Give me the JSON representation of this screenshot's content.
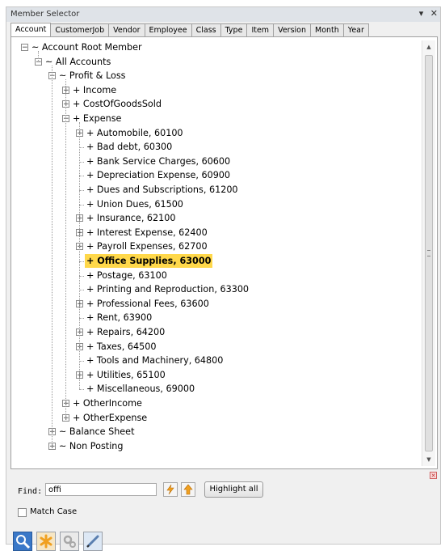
{
  "window": {
    "title": "Member Selector",
    "dropdown_glyph": "▾",
    "close_glyph": "✕"
  },
  "tabs": [
    {
      "label": "Account",
      "active": true
    },
    {
      "label": "CustomerJob"
    },
    {
      "label": "Vendor"
    },
    {
      "label": "Employee"
    },
    {
      "label": "Class"
    },
    {
      "label": "Type"
    },
    {
      "label": "Item"
    },
    {
      "label": "Version"
    },
    {
      "label": "Month"
    },
    {
      "label": "Year"
    }
  ],
  "tree": [
    {
      "label": "~ Account Root Member",
      "level": 0,
      "exp": "minus"
    },
    {
      "label": "~ All Accounts",
      "level": 1,
      "exp": "minus"
    },
    {
      "label": "~ Profit & Loss",
      "level": 2,
      "exp": "minus"
    },
    {
      "label": "+ Income",
      "level": 3,
      "exp": "plus"
    },
    {
      "label": "+ CostOfGoodsSold",
      "level": 3,
      "exp": "plus"
    },
    {
      "label": "+ Expense",
      "level": 3,
      "exp": "minus"
    },
    {
      "label": "+ Automobile, 60100",
      "level": 4,
      "exp": "plus"
    },
    {
      "label": "+ Bad debt, 60300",
      "level": 4
    },
    {
      "label": "+ Bank Service Charges, 60600",
      "level": 4
    },
    {
      "label": "+ Depreciation Expense, 60900",
      "level": 4
    },
    {
      "label": "+ Dues and Subscriptions, 61200",
      "level": 4
    },
    {
      "label": "+ Union Dues, 61500",
      "level": 4
    },
    {
      "label": "+ Insurance, 62100",
      "level": 4,
      "exp": "plus"
    },
    {
      "label": "+ Interest Expense, 62400",
      "level": 4,
      "exp": "plus"
    },
    {
      "label": "+ Payroll Expenses, 62700",
      "level": 4,
      "exp": "plus"
    },
    {
      "label": "+ Office Supplies, 63000",
      "level": 4,
      "highlight": true
    },
    {
      "label": "+ Postage, 63100",
      "level": 4
    },
    {
      "label": "+ Printing and Reproduction, 63300",
      "level": 4
    },
    {
      "label": "+ Professional Fees, 63600",
      "level": 4,
      "exp": "plus"
    },
    {
      "label": "+ Rent, 63900",
      "level": 4
    },
    {
      "label": "+ Repairs, 64200",
      "level": 4,
      "exp": "plus"
    },
    {
      "label": "+ Taxes, 64500",
      "level": 4,
      "exp": "plus"
    },
    {
      "label": "+ Tools and Machinery, 64800",
      "level": 4
    },
    {
      "label": "+ Utilities, 65100",
      "level": 4,
      "exp": "plus"
    },
    {
      "label": "+ Miscellaneous, 69000",
      "level": 4
    },
    {
      "label": "+ OtherIncome",
      "level": 3,
      "exp": "plus"
    },
    {
      "label": "+ OtherExpense",
      "level": 3,
      "exp": "plus"
    },
    {
      "label": "~ Balance Sheet",
      "level": 2,
      "exp": "plus"
    },
    {
      "label": "~ Non Posting",
      "level": 2,
      "exp": "plus"
    }
  ],
  "find": {
    "label": "Find:",
    "value": "offi",
    "prev_icon": "find-previous-icon",
    "next_icon": "find-next-icon",
    "highlight_all_label": "Highlight all"
  },
  "match_case": {
    "label": "Match Case",
    "checked": false
  },
  "toolbar": [
    {
      "name": "search-tool-button",
      "icon": "magnifier-icon"
    },
    {
      "name": "asterisk-tool-button",
      "icon": "asterisk-icon"
    },
    {
      "name": "settings-tool-button",
      "icon": "gears-icon"
    },
    {
      "name": "edit-tool-button",
      "icon": "pen-icon"
    }
  ],
  "colors": {
    "highlight": "#ffd84a",
    "toolbar_blue": "#3a78c8",
    "toolbar_orange": "#f0a020"
  }
}
